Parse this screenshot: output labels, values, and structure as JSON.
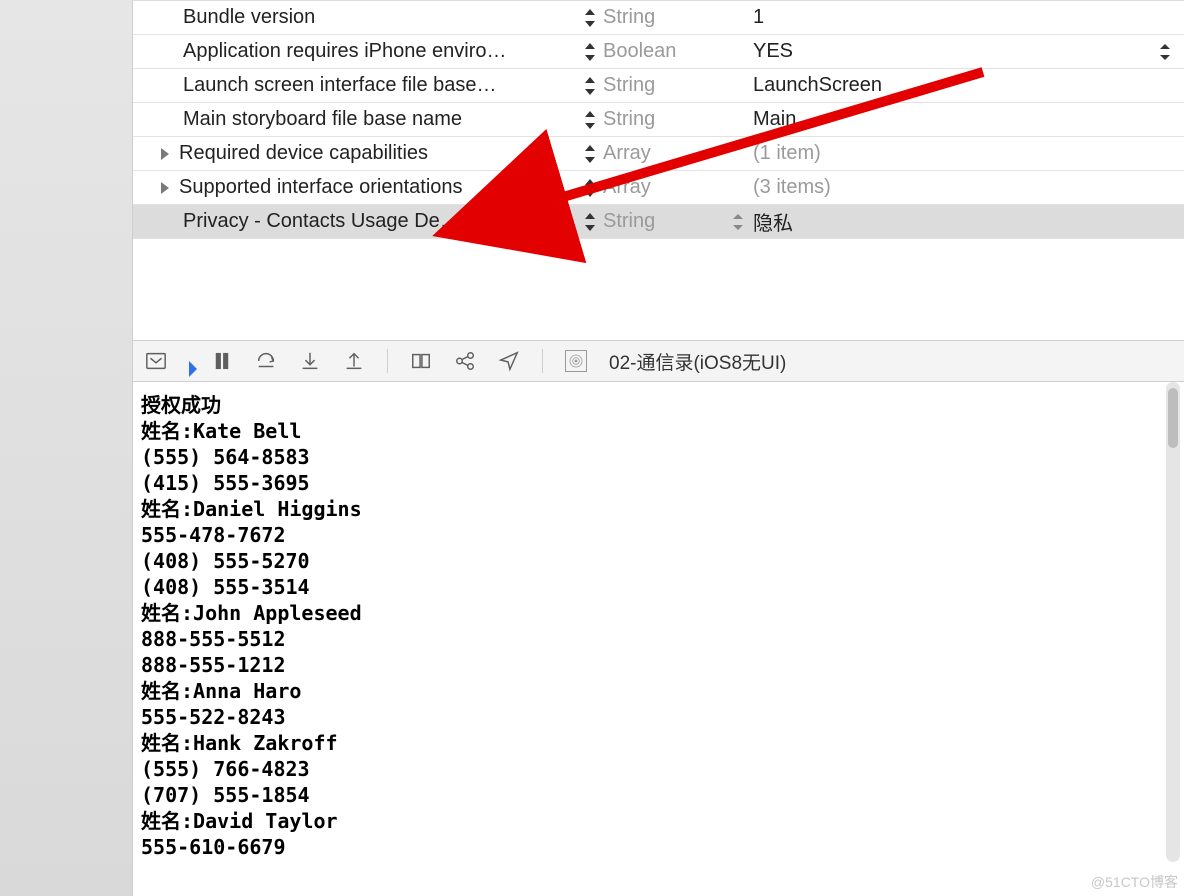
{
  "plist": {
    "rows": [
      {
        "key": "Bundle version",
        "type": "String",
        "value": "1",
        "expander": false,
        "selected": false,
        "typeStepper": false,
        "valStepper": false
      },
      {
        "key": "Application requires iPhone enviro…",
        "type": "Boolean",
        "value": "YES",
        "expander": false,
        "selected": false,
        "typeStepper": false,
        "valStepper": true
      },
      {
        "key": "Launch screen interface file base…",
        "type": "String",
        "value": "LaunchScreen",
        "expander": false,
        "selected": false,
        "typeStepper": false,
        "valStepper": false
      },
      {
        "key": "Main storyboard file base name",
        "type": "String",
        "value": "Main",
        "expander": false,
        "selected": false,
        "typeStepper": false,
        "valStepper": false
      },
      {
        "key": "Required device capabilities",
        "type": "Array",
        "value": "(1 item)",
        "muted": true,
        "expander": true,
        "selected": false,
        "typeStepper": false,
        "valStepper": false
      },
      {
        "key": "Supported interface orientations",
        "type": "Array",
        "value": "(3 items)",
        "muted": true,
        "expander": true,
        "selected": false,
        "typeStepper": false,
        "valStepper": false
      },
      {
        "key": "Privacy - Contacts Usage De…",
        "type": "String",
        "value": "隐私",
        "expander": false,
        "selected": true,
        "typeStepper": true,
        "valStepper": false
      }
    ]
  },
  "toolbar": {
    "target_label": "02-通信录(iOS8无UI)"
  },
  "console_lines": [
    "授权成功",
    "姓名:Kate Bell",
    "(555) 564-8583",
    "(415) 555-3695",
    "姓名:Daniel Higgins",
    "555-478-7672",
    "(408) 555-5270",
    "(408) 555-3514",
    "姓名:John Appleseed",
    "888-555-5512",
    "888-555-1212",
    "姓名:Anna Haro",
    "555-522-8243",
    "姓名:Hank Zakroff",
    "(555) 766-4823",
    "(707) 555-1854",
    "姓名:David Taylor",
    "555-610-6679"
  ],
  "watermark": "@51CTO博客"
}
